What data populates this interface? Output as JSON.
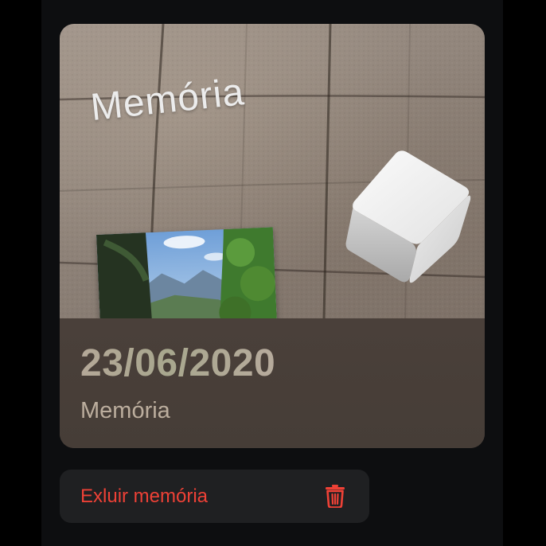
{
  "memory": {
    "ar_label": "Memória",
    "date": "23/06/2020",
    "title": "Memória"
  },
  "actions": {
    "delete_label": "Exluir memória",
    "delete_icon": "trash-icon"
  },
  "colors": {
    "background": "#0d0e10",
    "card_info_bg": "#463d37",
    "delete_text": "#ee4136",
    "button_bg": "#1f2022"
  }
}
